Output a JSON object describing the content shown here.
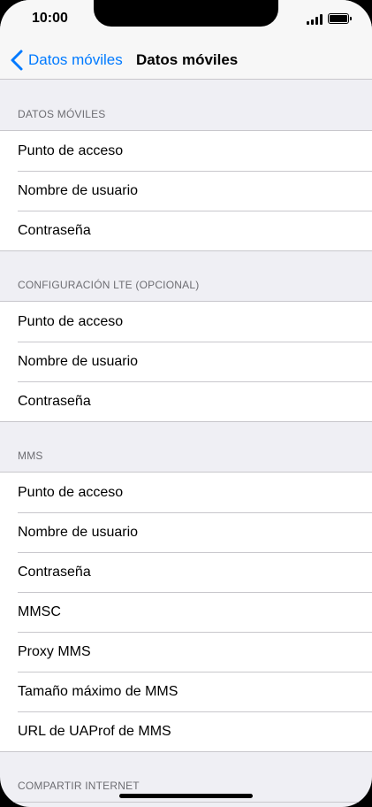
{
  "status_bar": {
    "time": "10:00"
  },
  "nav": {
    "back_label": "Datos móviles",
    "title": "Datos móviles"
  },
  "sections": [
    {
      "header": "DATOS MÓVILES",
      "items": [
        "Punto de acceso",
        "Nombre de usuario",
        "Contraseña"
      ]
    },
    {
      "header": "CONFIGURACIÓN LTE (OPCIONAL)",
      "items": [
        "Punto de acceso",
        "Nombre de usuario",
        "Contraseña"
      ]
    },
    {
      "header": "MMS",
      "items": [
        "Punto de acceso",
        "Nombre de usuario",
        "Contraseña",
        "MMSC",
        "Proxy MMS",
        "Tamaño máximo de MMS",
        "URL de UAProf de MMS"
      ]
    },
    {
      "header": "COMPARTIR INTERNET",
      "items": []
    }
  ],
  "colors": {
    "accent": "#007aff",
    "background": "#efeff4",
    "separator": "#c8c7cc"
  }
}
